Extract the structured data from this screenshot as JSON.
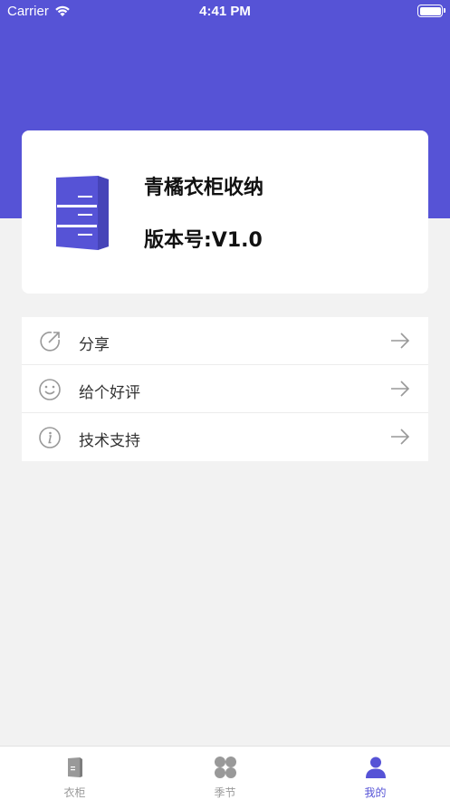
{
  "status_bar": {
    "carrier": "Carrier",
    "time": "4:41 PM"
  },
  "app_card": {
    "name": "青橘衣柜收纳",
    "version": "版本号:V1.0",
    "icon": "wardrobe-icon"
  },
  "menu": {
    "items": [
      {
        "label": "分享",
        "icon": "share-icon"
      },
      {
        "label": "给个好评",
        "icon": "smiley-icon"
      },
      {
        "label": "技术支持",
        "icon": "info-icon"
      }
    ]
  },
  "tab_bar": {
    "tabs": [
      {
        "label": "衣柜",
        "icon": "wardrobe-tab-icon"
      },
      {
        "label": "季节",
        "icon": "grid-icon"
      },
      {
        "label": "我的",
        "icon": "user-icon",
        "active": true
      }
    ]
  },
  "colors": {
    "accent": "#5653d6",
    "background": "#f2f2f2",
    "inactive": "#999999"
  }
}
